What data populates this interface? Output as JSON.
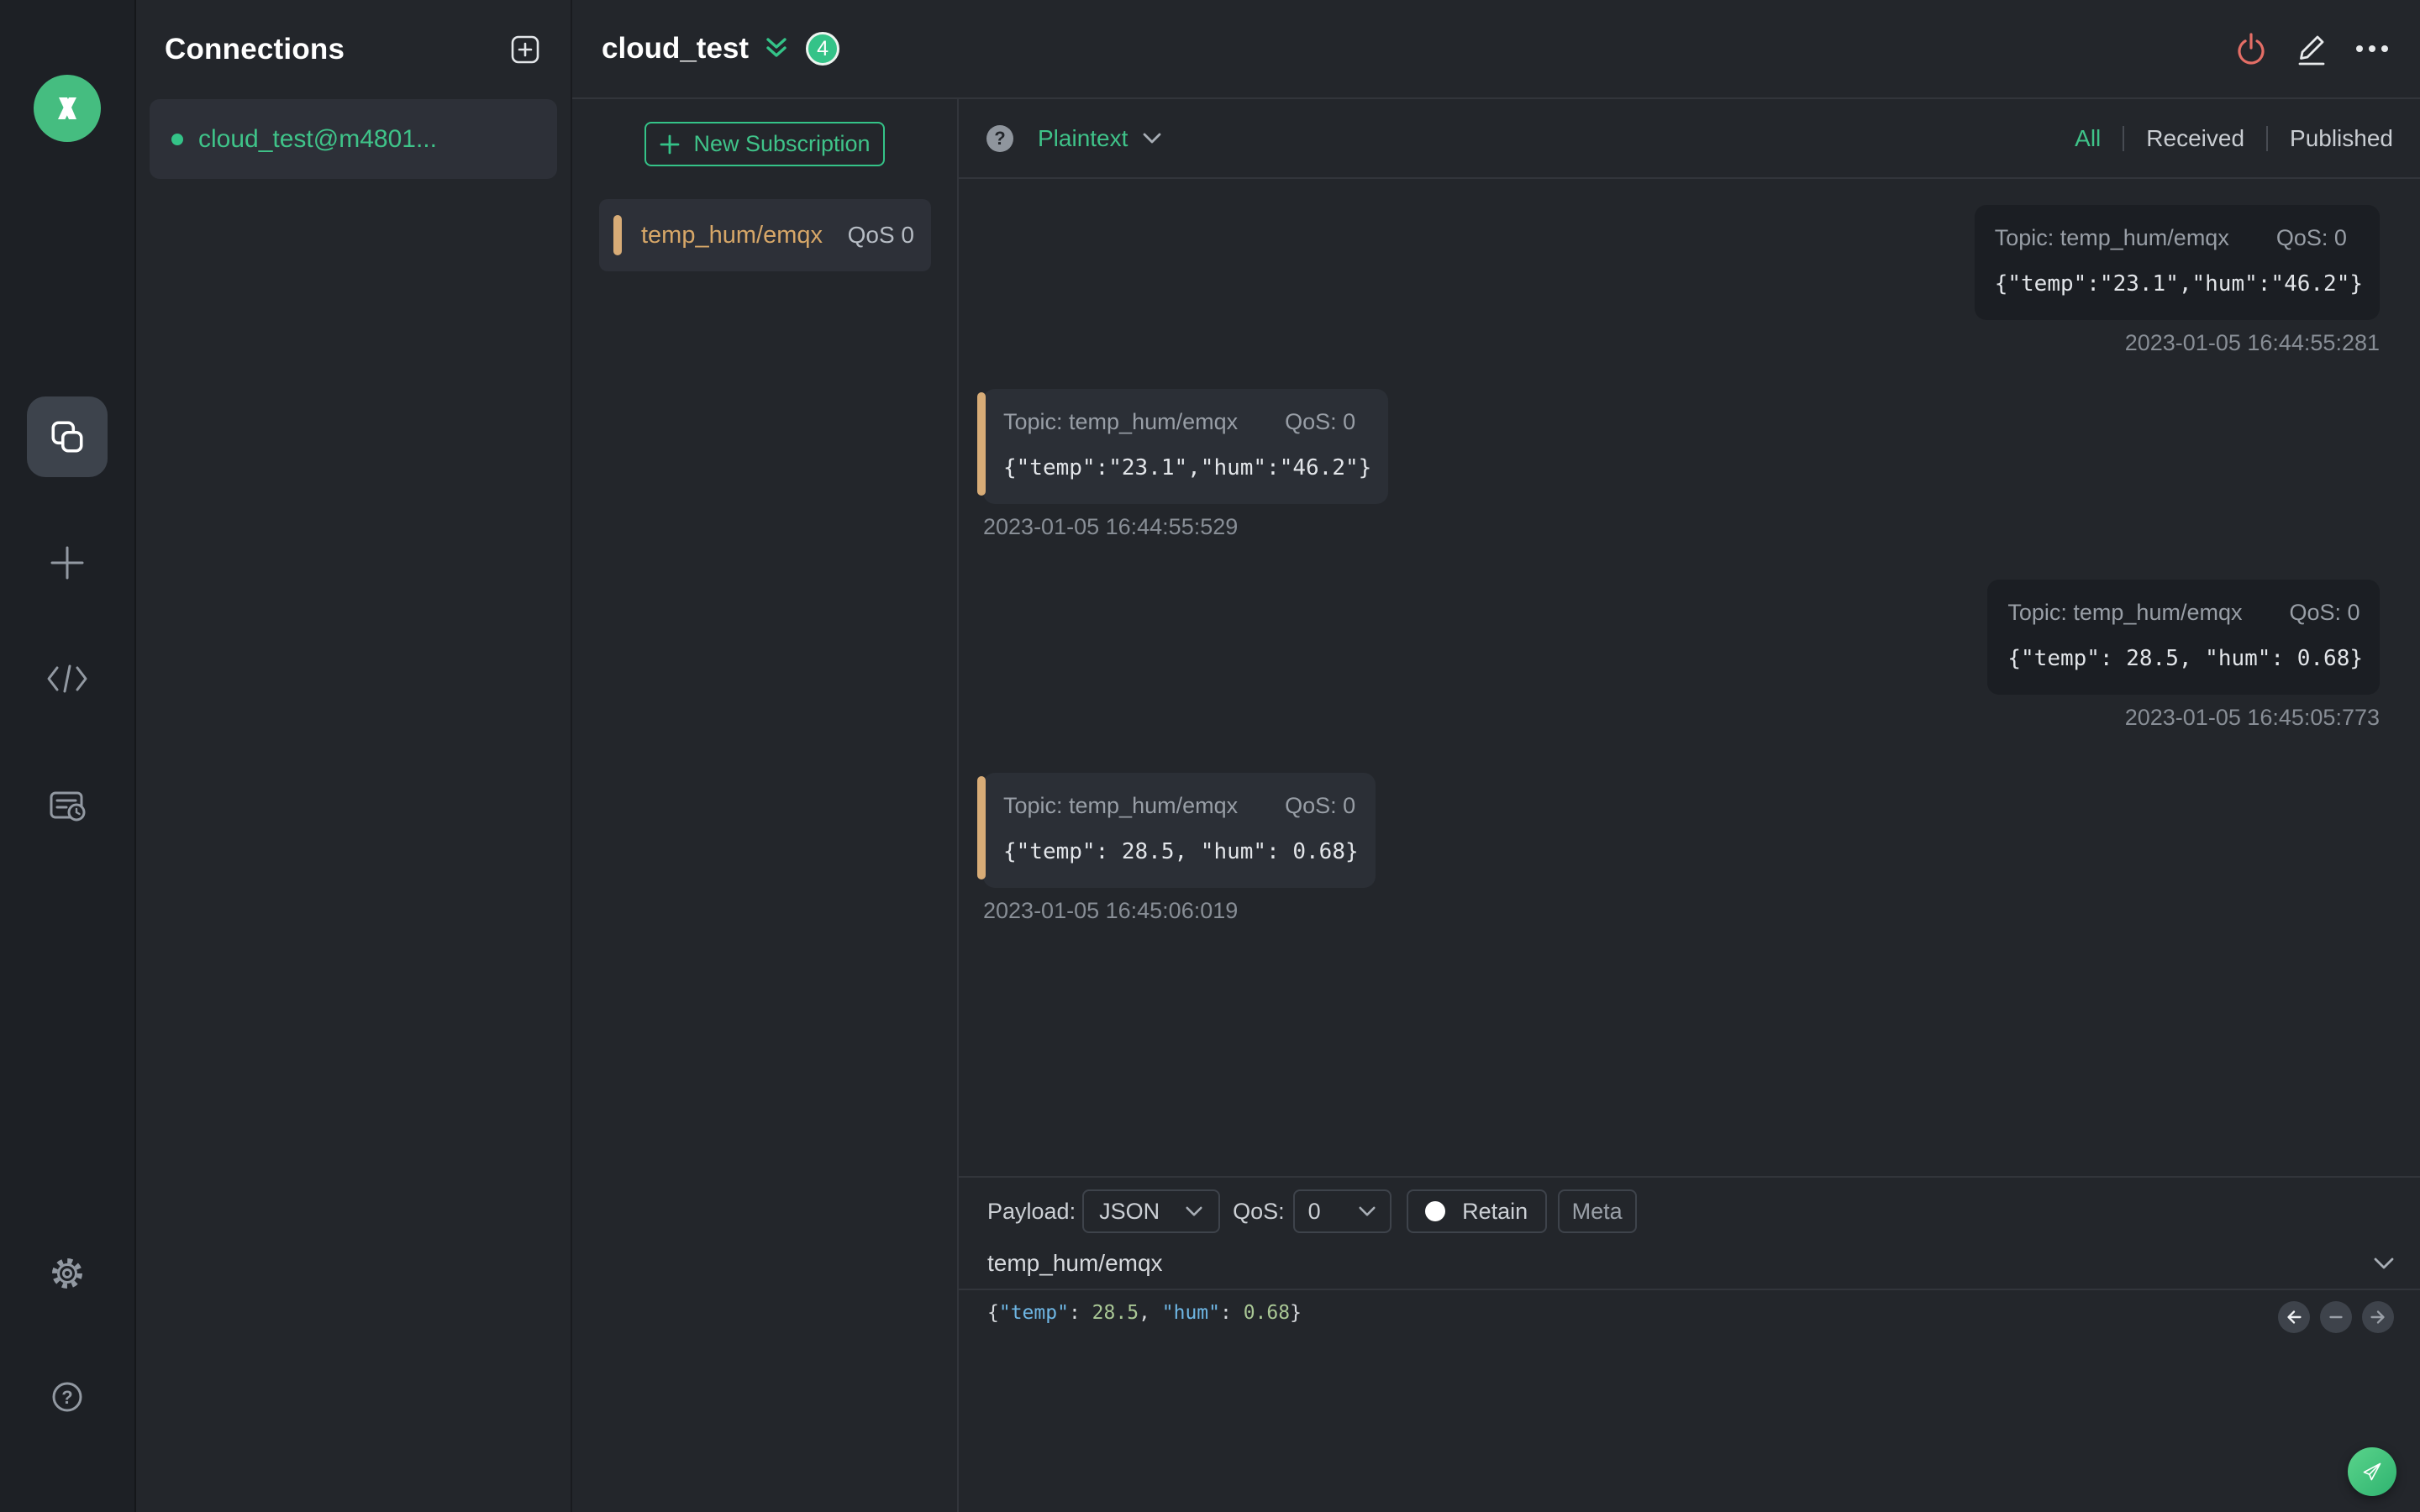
{
  "connections_panel": {
    "title": "Connections",
    "connection": {
      "name": "cloud_test@m4801..."
    }
  },
  "topbar": {
    "title": "cloud_test",
    "badge_count": "4"
  },
  "subscriptions": {
    "new_button": "New Subscription",
    "item": {
      "topic": "temp_hum/emqx",
      "qos": "QoS 0"
    }
  },
  "messages_header": {
    "format": "Plaintext",
    "help_glyph": "?",
    "tabs": {
      "all": "All",
      "received": "Received",
      "published": "Published"
    }
  },
  "messages": {
    "items": [
      {
        "direction": "published",
        "topic_label": "Topic: temp_hum/emqx",
        "qos_label": "QoS: 0",
        "payload": "{\"temp\":\"23.1\",\"hum\":\"46.2\"}",
        "timestamp": "2023-01-05 16:44:55:281"
      },
      {
        "direction": "received",
        "topic_label": "Topic: temp_hum/emqx",
        "qos_label": "QoS: 0",
        "payload": "{\"temp\":\"23.1\",\"hum\":\"46.2\"}",
        "timestamp": "2023-01-05 16:44:55:529"
      },
      {
        "direction": "published",
        "topic_label": "Topic: temp_hum/emqx",
        "qos_label": "QoS: 0",
        "payload": "{\"temp\": 28.5, \"hum\": 0.68}",
        "timestamp": "2023-01-05 16:45:05:773"
      },
      {
        "direction": "received",
        "topic_label": "Topic: temp_hum/emqx",
        "qos_label": "QoS: 0",
        "payload": "{\"temp\": 28.5, \"hum\": 0.68}",
        "timestamp": "2023-01-05 16:45:06:019"
      }
    ]
  },
  "publish": {
    "payload_label": "Payload:",
    "format_value": "JSON",
    "qos_label": "QoS:",
    "qos_value": "0",
    "retain_label": "Retain",
    "meta_label": "Meta",
    "topic_value": "temp_hum/emqx",
    "editor_tokens": [
      {
        "text": "{",
        "color": "#d5d8dc"
      },
      {
        "text": "\"temp\"",
        "color": "#6eb6e4"
      },
      {
        "text": ": ",
        "color": "#d5d8dc"
      },
      {
        "text": "28.5",
        "color": "#a9c795"
      },
      {
        "text": ", ",
        "color": "#d5d8dc"
      },
      {
        "text": "\"hum\"",
        "color": "#6eb6e4"
      },
      {
        "text": ": ",
        "color": "#d5d8dc"
      },
      {
        "text": "0.68",
        "color": "#a9c795"
      },
      {
        "text": "}",
        "color": "#d5d8dc"
      }
    ]
  },
  "colors": {
    "accent_green": "#34c388",
    "tan": "#d8ac77",
    "danger_red": "#e46e66",
    "key_blue": "#6eb6e4",
    "value_green": "#a9c795",
    "rail_bg": "#1d2025",
    "panel_bg": "#23262b",
    "card_published": "#1b1e23",
    "card_received": "#2b2f36"
  }
}
